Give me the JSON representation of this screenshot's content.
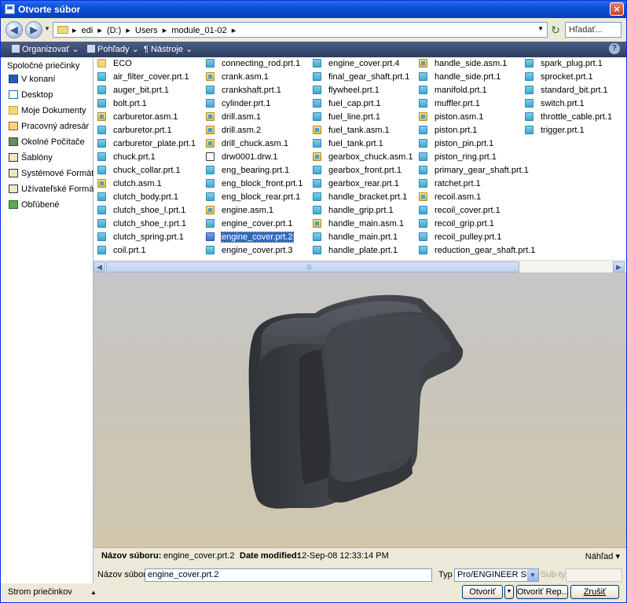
{
  "window": {
    "title": "Otvorte súbor",
    "close_label": "×"
  },
  "address": {
    "breadcrumbs": [
      "edi",
      "(D:)",
      "Users",
      "module_01-02"
    ],
    "search_placeholder": "Hľadať..."
  },
  "toolbar": {
    "organize": "Organizovať",
    "views": "Pohľady",
    "tools": "Nástroje"
  },
  "sidebar": {
    "heading": "Spoločné priečinky",
    "items": [
      {
        "label": "V konaní",
        "icon": "monitor-icon"
      },
      {
        "label": "Desktop",
        "icon": "desktop-icon"
      },
      {
        "label": "Moje Dokumenty",
        "icon": "folder-open-icon"
      },
      {
        "label": "Pracovný adresár",
        "icon": "working-folder-icon"
      },
      {
        "label": "Okolné Počítače",
        "icon": "network-icon"
      },
      {
        "label": "Šablóny",
        "icon": "templates-icon"
      },
      {
        "label": "Systémové Formáty",
        "icon": "system-formats-icon"
      },
      {
        "label": "Užívateľské Formáty",
        "icon": "user-formats-icon"
      },
      {
        "label": "Obľúbené",
        "icon": "favorites-icon"
      }
    ],
    "tree_label": "Strom priečinkov"
  },
  "files": {
    "columns": [
      [
        {
          "name": "ECO",
          "type": "folder"
        },
        {
          "name": "air_filter_cover.prt.1",
          "type": "prt"
        },
        {
          "name": "auger_bit.prt.1",
          "type": "prt"
        },
        {
          "name": "bolt.prt.1",
          "type": "prt"
        },
        {
          "name": "carburetor.asm.1",
          "type": "asm"
        },
        {
          "name": "carburetor.prt.1",
          "type": "prt"
        },
        {
          "name": "carburetor_plate.prt.1",
          "type": "prt"
        },
        {
          "name": "chuck.prt.1",
          "type": "prt"
        },
        {
          "name": "chuck_collar.prt.1",
          "type": "prt"
        },
        {
          "name": "clutch.asm.1",
          "type": "asm"
        },
        {
          "name": "clutch_body.prt.1",
          "type": "prt"
        },
        {
          "name": "clutch_shoe_l.prt.1",
          "type": "prt"
        },
        {
          "name": "clutch_shoe_r.prt.1",
          "type": "prt"
        },
        {
          "name": "clutch_spring.prt.1",
          "type": "prt"
        },
        {
          "name": "coil.prt.1",
          "type": "prt"
        }
      ],
      [
        {
          "name": "connecting_rod.prt.1",
          "type": "prt"
        },
        {
          "name": "crank.asm.1",
          "type": "asm"
        },
        {
          "name": "crankshaft.prt.1",
          "type": "prt"
        },
        {
          "name": "cylinder.prt.1",
          "type": "prt"
        },
        {
          "name": "drill.asm.1",
          "type": "asm"
        },
        {
          "name": "drill.asm.2",
          "type": "asm"
        },
        {
          "name": "drill_chuck.asm.1",
          "type": "asm"
        },
        {
          "name": "drw0001.drw.1",
          "type": "drw"
        },
        {
          "name": "eng_bearing.prt.1",
          "type": "prt"
        },
        {
          "name": "eng_block_front.prt.1",
          "type": "prt"
        },
        {
          "name": "eng_block_rear.prt.1",
          "type": "prt"
        },
        {
          "name": "engine.asm.1",
          "type": "asm"
        },
        {
          "name": "engine_cover.prt.1",
          "type": "prt"
        },
        {
          "name": "engine_cover.prt.2",
          "type": "sel"
        },
        {
          "name": "engine_cover.prt.3",
          "type": "prt"
        }
      ],
      [
        {
          "name": "engine_cover.prt.4",
          "type": "prt"
        },
        {
          "name": "final_gear_shaft.prt.1",
          "type": "prt"
        },
        {
          "name": "flywheel.prt.1",
          "type": "prt"
        },
        {
          "name": "fuel_cap.prt.1",
          "type": "prt"
        },
        {
          "name": "fuel_line.prt.1",
          "type": "prt"
        },
        {
          "name": "fuel_tank.asm.1",
          "type": "asm"
        },
        {
          "name": "fuel_tank.prt.1",
          "type": "prt"
        },
        {
          "name": "gearbox_chuck.asm.1",
          "type": "asm"
        },
        {
          "name": "gearbox_front.prt.1",
          "type": "prt"
        },
        {
          "name": "gearbox_rear.prt.1",
          "type": "prt"
        },
        {
          "name": "handle_bracket.prt.1",
          "type": "prt"
        },
        {
          "name": "handle_grip.prt.1",
          "type": "prt"
        },
        {
          "name": "handle_main.asm.1",
          "type": "asm"
        },
        {
          "name": "handle_main.prt.1",
          "type": "prt"
        },
        {
          "name": "handle_plate.prt.1",
          "type": "prt"
        }
      ],
      [
        {
          "name": "handle_side.asm.1",
          "type": "asm"
        },
        {
          "name": "handle_side.prt.1",
          "type": "prt"
        },
        {
          "name": "manifold.prt.1",
          "type": "prt"
        },
        {
          "name": "muffler.prt.1",
          "type": "prt"
        },
        {
          "name": "piston.asm.1",
          "type": "asm"
        },
        {
          "name": "piston.prt.1",
          "type": "prt"
        },
        {
          "name": "piston_pin.prt.1",
          "type": "prt"
        },
        {
          "name": "piston_ring.prt.1",
          "type": "prt"
        },
        {
          "name": "primary_gear_shaft.prt.1",
          "type": "prt"
        },
        {
          "name": "ratchet.prt.1",
          "type": "prt"
        },
        {
          "name": "recoil.asm.1",
          "type": "asm"
        },
        {
          "name": "recoil_cover.prt.1",
          "type": "prt"
        },
        {
          "name": "recoil_grip.prt.1",
          "type": "prt"
        },
        {
          "name": "recoil_pulley.prt.1",
          "type": "prt"
        },
        {
          "name": "reduction_gear_shaft.prt.1",
          "type": "prt"
        }
      ],
      [
        {
          "name": "spark_plug.prt.1",
          "type": "prt"
        },
        {
          "name": "sprocket.prt.1",
          "type": "prt"
        },
        {
          "name": "standard_bit.prt.1",
          "type": "prt"
        },
        {
          "name": "switch.prt.1",
          "type": "prt"
        },
        {
          "name": "throttle_cable.prt.1",
          "type": "prt"
        },
        {
          "name": "trigger.prt.1",
          "type": "prt"
        }
      ]
    ]
  },
  "info": {
    "name_label": "Názov súboru:",
    "name_value": "engine_cover.prt.2",
    "modified_label": "Date modified:",
    "modified_value": "12-Sep-08 12:33:14 PM",
    "preview_label": "Náhľad"
  },
  "form": {
    "name_label": "Názov súboru:",
    "name_value": "engine_cover.prt.2",
    "type_label": "Typ",
    "type_value": "Pro/ENGINEER Súbor",
    "subtype_label": "Sub-typ"
  },
  "buttons": {
    "open": "Otvoriť",
    "open_rep": "Otvoriť Rep...",
    "cancel": "Zrušiť"
  },
  "colors": {
    "titlebar": "#0b4fd8",
    "selection": "#316ac5",
    "model": "#3d4146"
  }
}
